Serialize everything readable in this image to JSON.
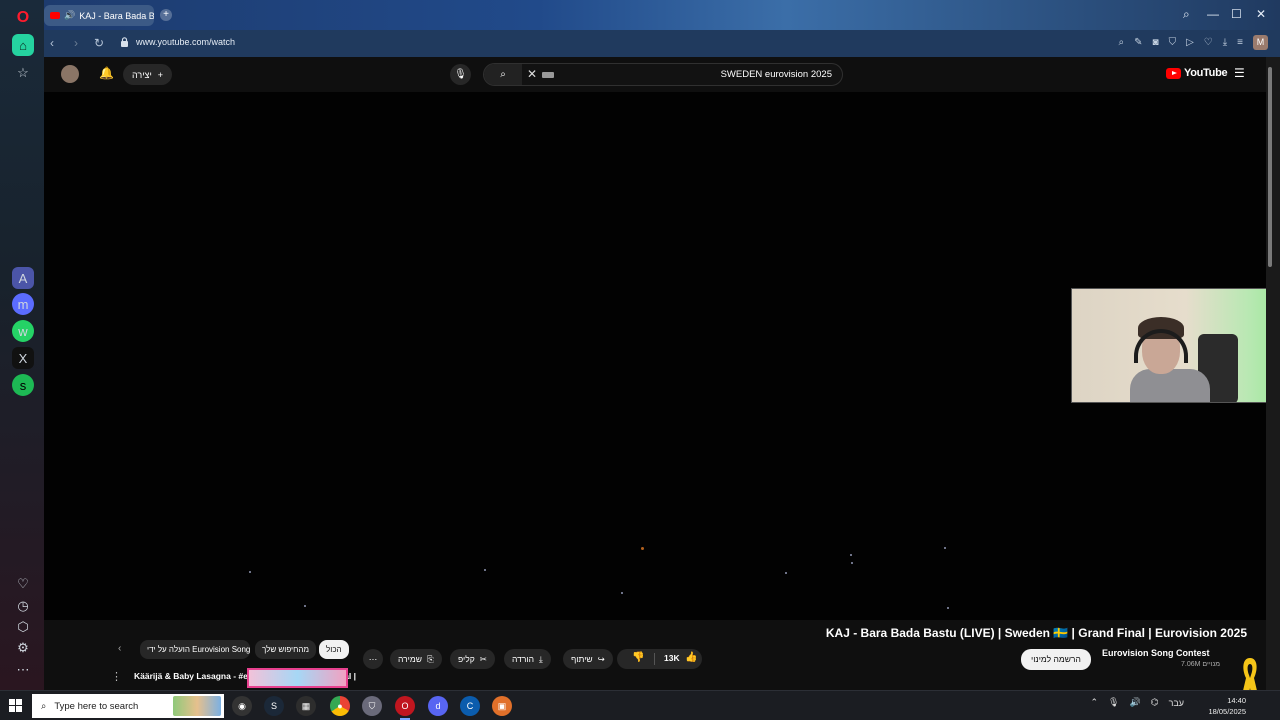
{
  "browser": {
    "tab_title": "KAJ - Bara Bada Bastu",
    "url": "www.youtube.com/watch"
  },
  "youtube": {
    "create_label": "יצירה",
    "search_query": "SWEDEN eurovision 2025",
    "logo_text": "YouTube",
    "video_title": "KAJ - Bara Bada Bastu (LIVE) | Sweden 🇸🇪 | Grand Final | Eurovision 2025",
    "channel_name": "Eurovision Song Contest",
    "subscriber_count": "7.06M מנויים",
    "subscribe_label": "הרשמה למינוי",
    "likes": "13K",
    "share_label": "שיתוף",
    "download_label": "הורדה",
    "clip_label": "קליפ",
    "save_label": "שמירה",
    "chips": [
      "הכול",
      "מהחיפוש שלך",
      "הועלה על ידי Eurovision Song Contest"
    ],
    "recommendation_title": "Käärijä & Baby Lasagna - #eurodab at the Grand Final |"
  },
  "taskbar": {
    "search_placeholder": "Type here to search",
    "language": "עבר",
    "time": "14:40",
    "date": "18/05/2025"
  },
  "colors": {
    "youtube_red": "#ff0000",
    "opera_red": "#ff1b2d",
    "opera_home_green": "#25d3a0"
  }
}
